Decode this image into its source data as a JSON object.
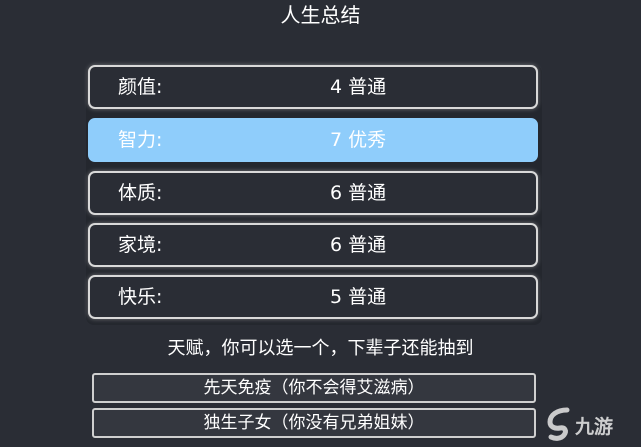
{
  "title": "人生总结",
  "stats": [
    {
      "label": "颜值:",
      "value": "4",
      "rank": "普通",
      "highlight": false
    },
    {
      "label": "智力:",
      "value": "7",
      "rank": "优秀",
      "highlight": true
    },
    {
      "label": "体质:",
      "value": "6",
      "rank": "普通",
      "highlight": false
    },
    {
      "label": "家境:",
      "value": "6",
      "rank": "普通",
      "highlight": false
    },
    {
      "label": "快乐:",
      "value": "5",
      "rank": "普通",
      "highlight": false
    }
  ],
  "talent_heading": "天赋，你可以选一个，下辈子还能抽到",
  "talents": [
    {
      "label": "先天免疫（你不会得艾滋病）"
    },
    {
      "label": "独生子女（你没有兄弟姐妹）"
    }
  ],
  "watermark": {
    "text": "九游",
    "icon": "swirl-logo-icon"
  },
  "colors": {
    "background": "#2a2d35",
    "highlight": "#8fcdfb",
    "border": "#d9d9d9"
  }
}
